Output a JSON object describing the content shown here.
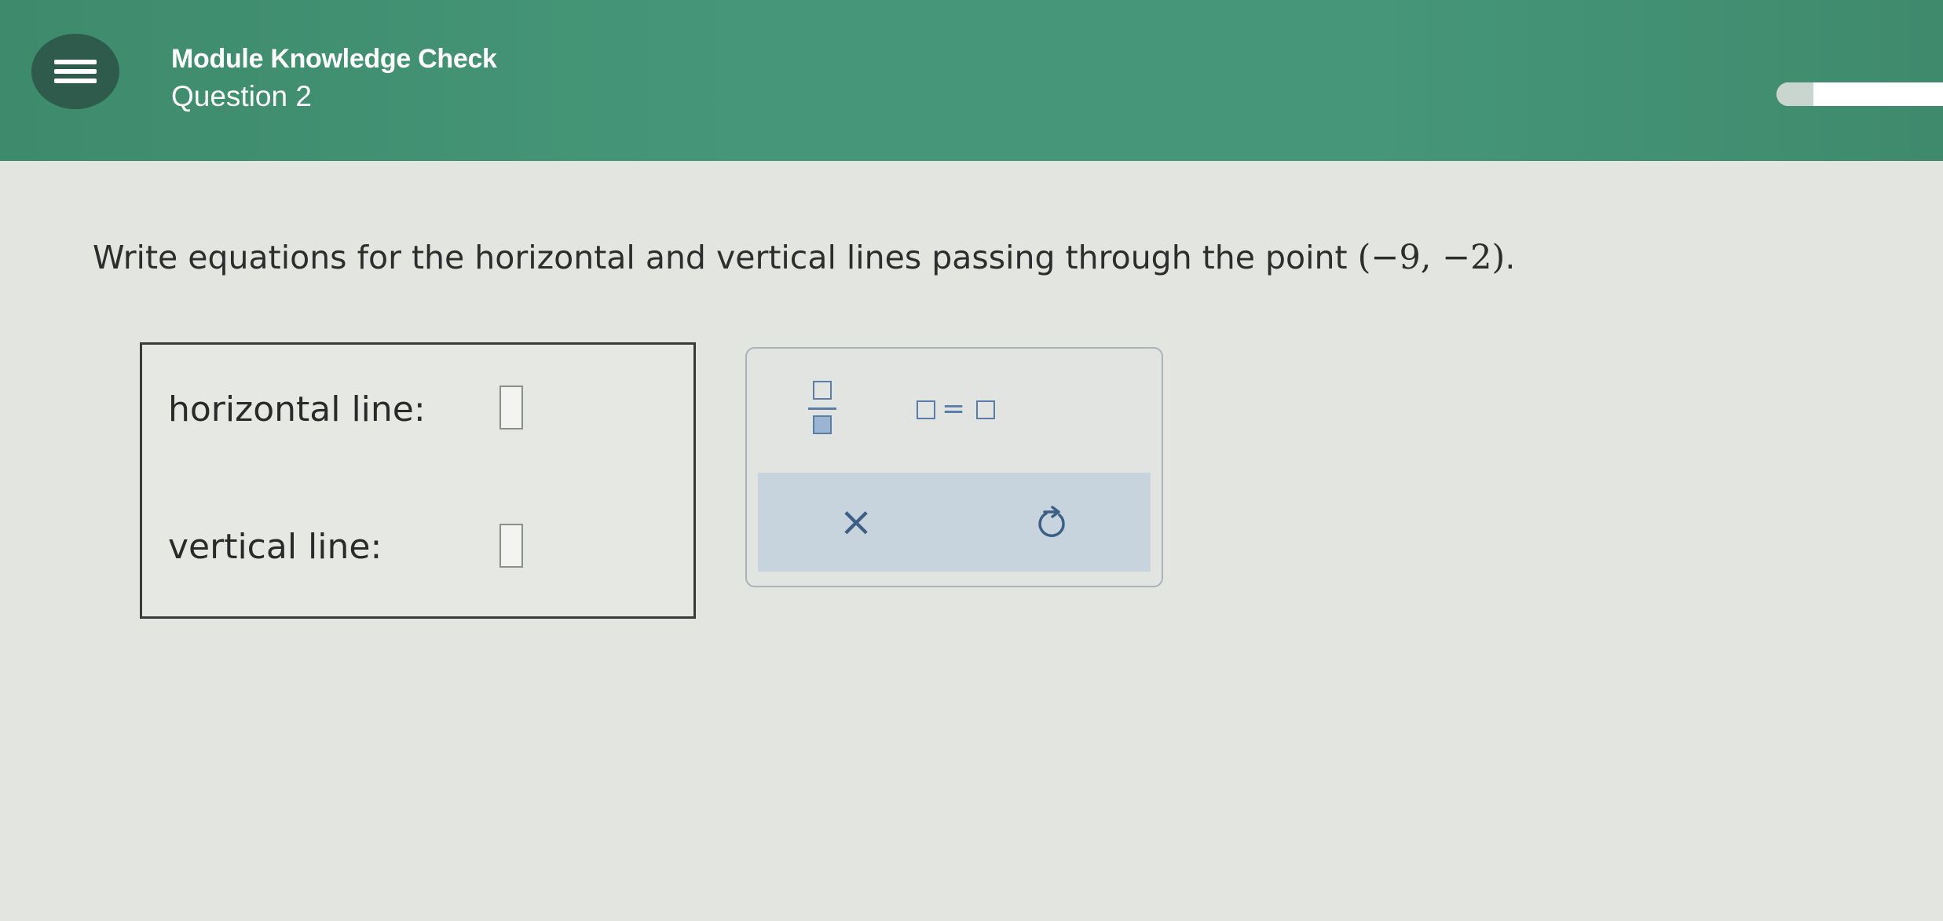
{
  "header": {
    "module_title": "Module Knowledge Check",
    "question_title": "Question 2",
    "progress_fraction": 0.22,
    "colors": {
      "header_bg": "#46967a",
      "menu_button_bg": "#2e5b4c",
      "title_text": "#ffffff"
    },
    "icons": {
      "menu": "hamburger-menu-icon"
    }
  },
  "question": {
    "prompt_text": "Write equations for the horizontal and vertical lines passing through the point ",
    "point": "(−9, −2)",
    "period": "."
  },
  "answers": {
    "horizontal_label": "horizontal line:",
    "horizontal_value": "",
    "vertical_label": "vertical line:",
    "vertical_value": ""
  },
  "toolbar": {
    "fraction_tool": "fraction-icon",
    "equals_tool": "equation-icon",
    "equals_symbol": "=",
    "clear_symbol": "×",
    "undo_tool": "undo-icon",
    "accent_color": "#5a7ea8",
    "action_bar_color": "#c7d3dd"
  }
}
